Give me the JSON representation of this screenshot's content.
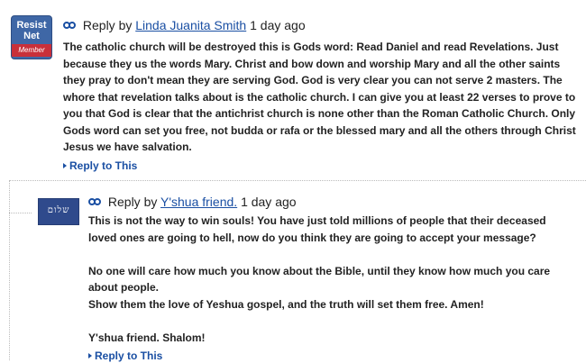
{
  "comments": [
    {
      "avatar": {
        "line1": "Resist",
        "line2": "Net",
        "badge": "Member"
      },
      "reply_prefix": "Reply by",
      "author": "Linda Juanita Smith",
      "time": "1 day ago",
      "body": [
        "The catholic church will be destroyed this is Gods word: Read Daniel and read Revelations. Just because they us the words Mary. Christ and bow down and worship Mary and all the other saints they pray to don't mean they are serving God. God is very clear you can not serve 2 masters. The whore that revelation talks about is the catholic church. I can give you at least 22 verses to prove to you that God is clear that the antichrist church is none other than the Roman Catholic Church. Only Gods word can set you free, not budda or rafa or the blessed mary and all the others through Christ Jesus we have salvation."
      ],
      "reply_link": "Reply to This"
    },
    {
      "reply_prefix": "Reply by",
      "author": "Y'shua friend.",
      "time": "1 day ago",
      "body": [
        "This is not the way to win souls! You have just told millions of people that their deceased loved ones are going to hell, now do you think they are going to accept your message?",
        "",
        "No one will care how much you know about the Bible, until they know how much you care about people.",
        "Show them the love of Yeshua gospel, and the truth will set them free. Amen!",
        "",
        "Y'shua friend. Shalom!"
      ],
      "reply_link": "Reply to This"
    }
  ],
  "colors": {
    "link": "#1a4fa3",
    "avatar1_bg": "#3f67a6",
    "avatar2_bg": "#2f4a8c",
    "badge": "#c8303a"
  },
  "icons": {
    "reply_marker": "link-chain-icon",
    "reply_arrow": "triangle-right-icon"
  }
}
